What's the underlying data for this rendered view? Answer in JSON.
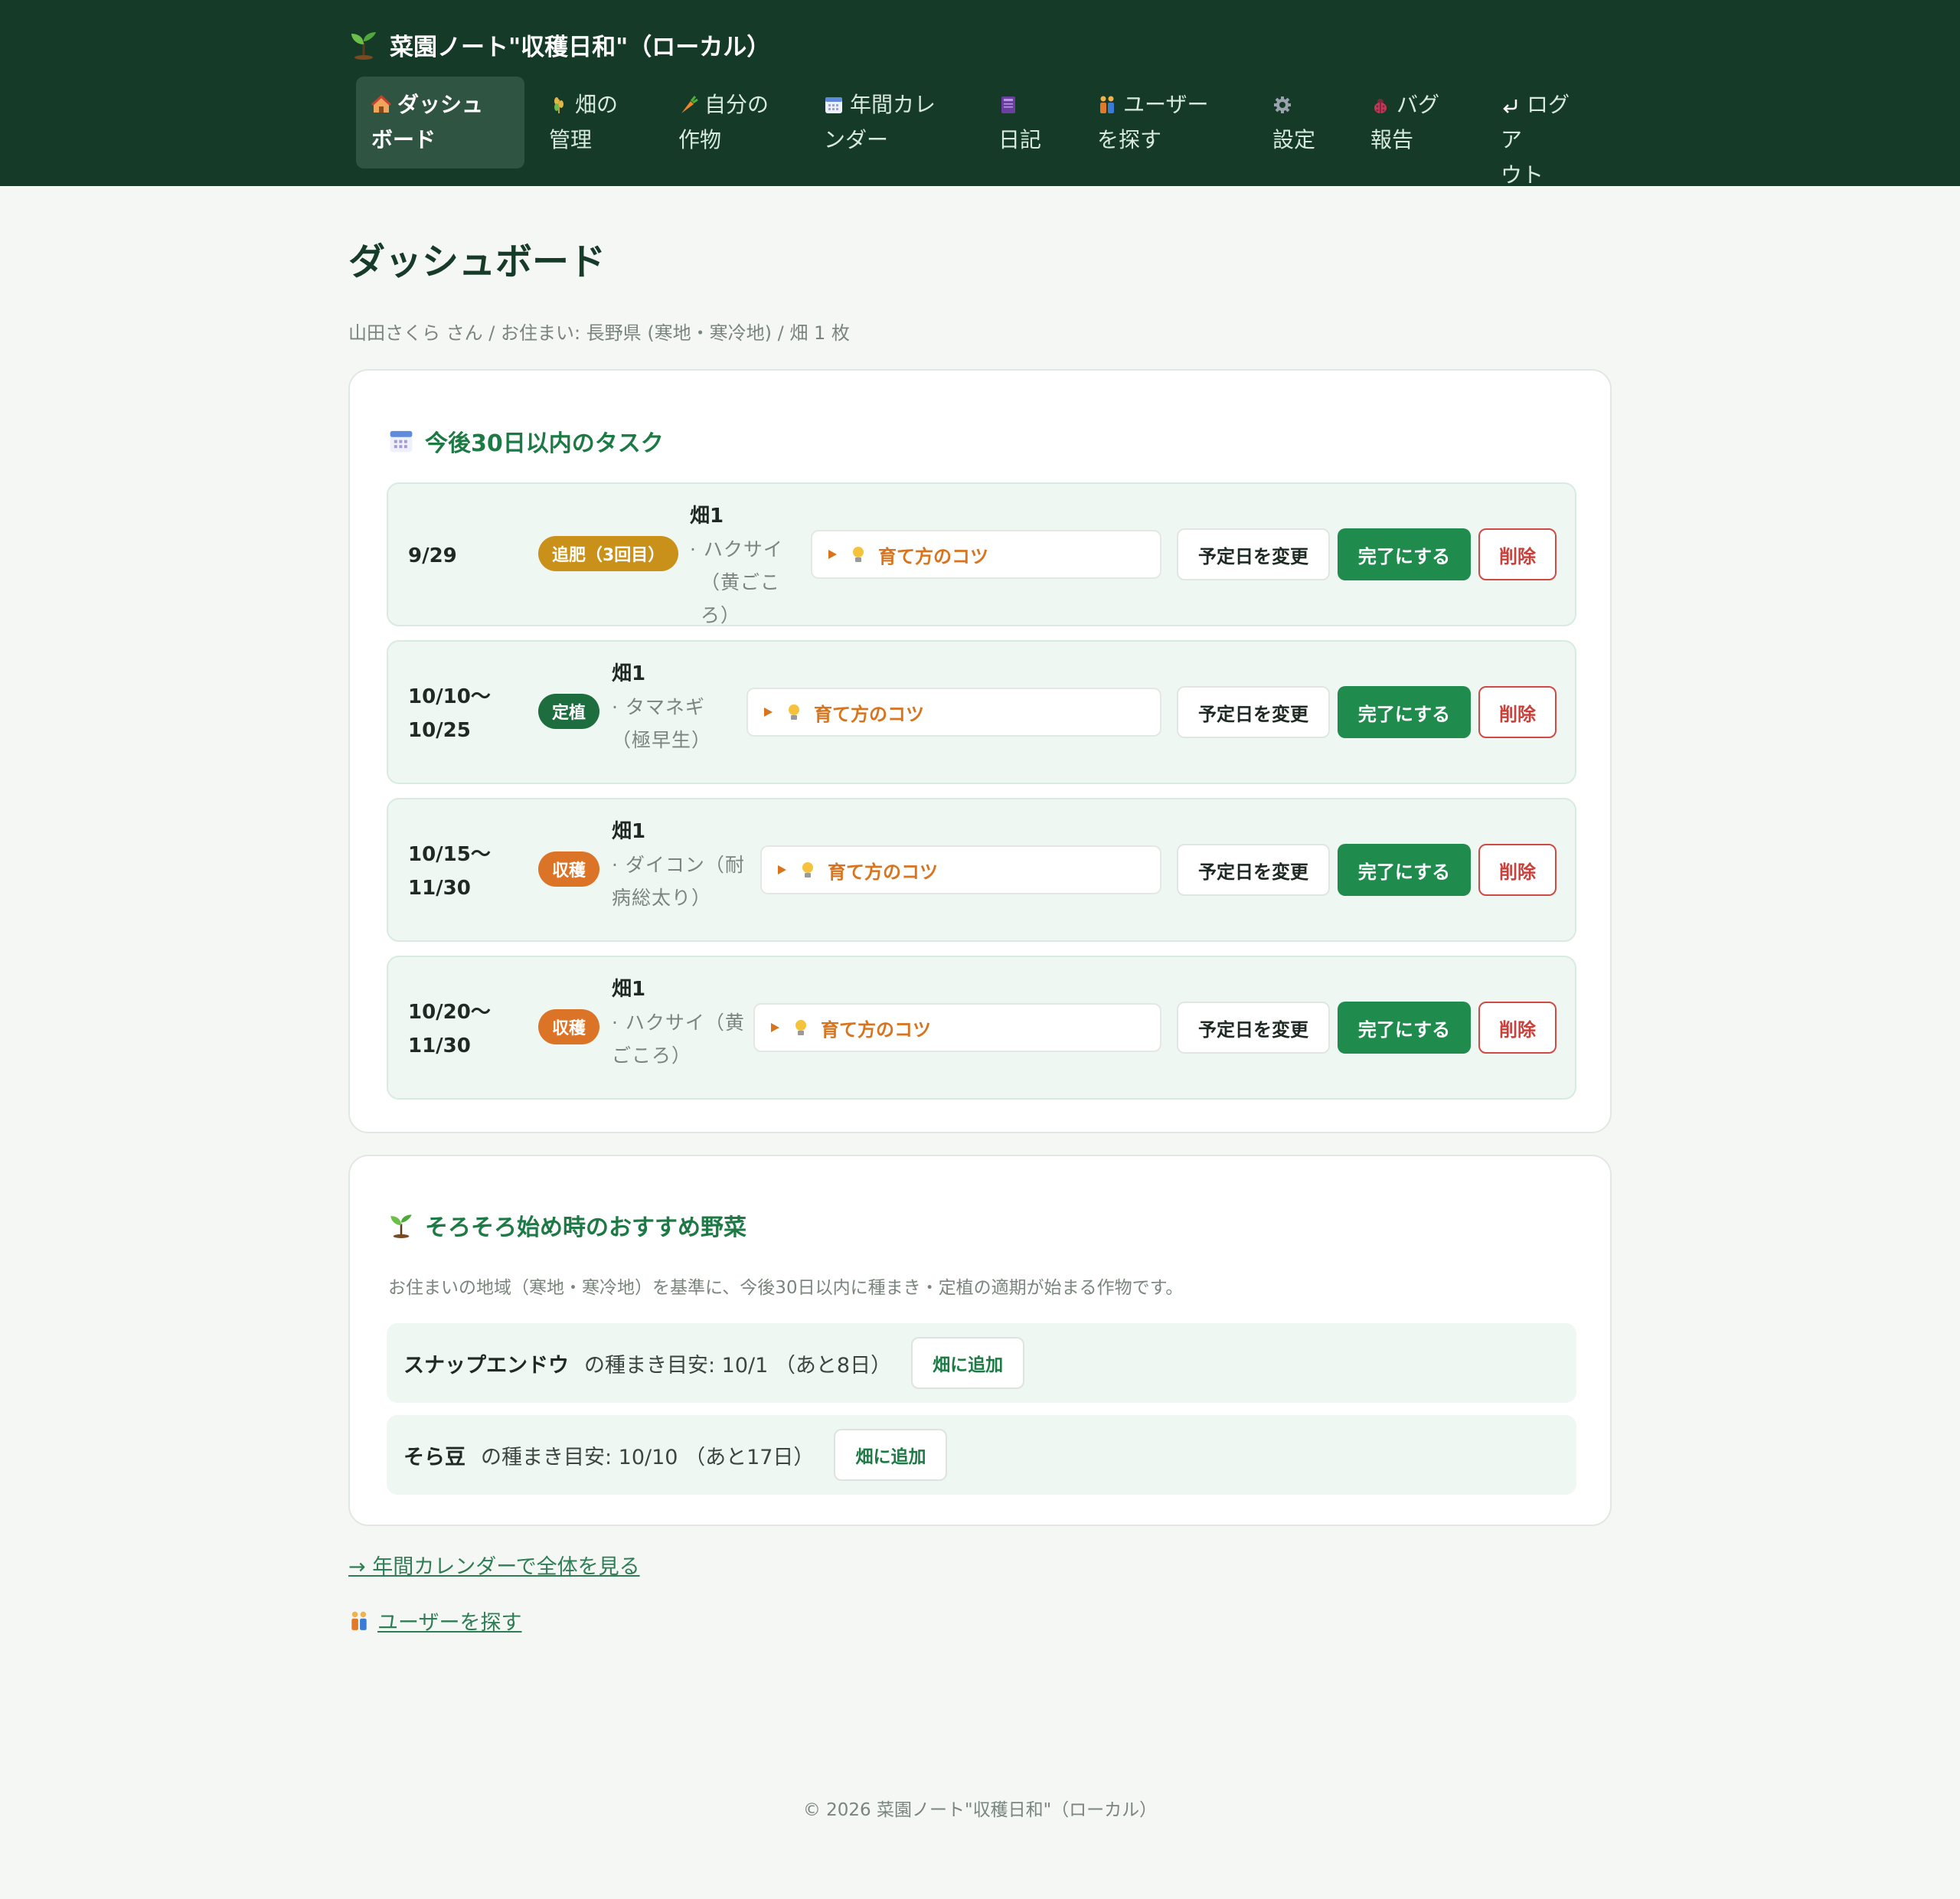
{
  "app": {
    "title": "菜園ノート\"収穫日和\"（ローカル）"
  },
  "nav": [
    {
      "label_line1": "ダッシュ",
      "label_line2": "ボード",
      "icon": "house-icon"
    },
    {
      "label_line1": "畑の",
      "label_line2": "管理",
      "icon": "wheat-icon"
    },
    {
      "label_line1": "自分の",
      "label_line2": "作物",
      "icon": "carrot-icon"
    },
    {
      "label_line1": "年間カレ",
      "label_line2": "ンダー",
      "icon": "calendar-icon"
    },
    {
      "label_line1": "",
      "label_line2": "日記",
      "icon": "notebook-icon"
    },
    {
      "label_line1": "ユーザー",
      "label_line2": "を探す",
      "icon": "people-icon"
    },
    {
      "label_line1": "",
      "label_line2": "設定",
      "icon": "gear-icon"
    },
    {
      "label_line1": "バグ",
      "label_line2": "報告",
      "icon": "bug-icon"
    },
    {
      "label_line1": "ログア",
      "label_line2": "ウト",
      "icon": "logout-arrow-icon"
    }
  ],
  "page": {
    "title": "ダッシュボード",
    "subtitle": "山田さくら さん / お住まい: 長野県 (寒地・寒冷地) / 畑 1 枚"
  },
  "tasks": {
    "heading": "今後30日以内のタスク",
    "tips_label": "育て方のコツ",
    "reschedule_label": "予定日を変更",
    "done_label": "完了にする",
    "delete_label": "削除",
    "items": [
      {
        "date_line1": "9/29",
        "date_line2": "",
        "type": "追肥（3回目）",
        "field": "畑1",
        "crop_line1": "· ハクサイ",
        "crop_line2": "（黄ごころ）"
      },
      {
        "date_line1": "10/10〜",
        "date_line2": "10/25",
        "type": "定植",
        "field": "畑1",
        "crop_line1": "· タマネギ",
        "crop_line2": "（極早生）"
      },
      {
        "date_line1": "10/15〜",
        "date_line2": "11/30",
        "type": "収穫",
        "field": "畑1",
        "crop_line1": "· ダイコン（耐",
        "crop_line2": "病総太り）"
      },
      {
        "date_line1": "10/20〜",
        "date_line2": "11/30",
        "type": "収穫",
        "field": "畑1",
        "crop_line1": "· ハクサイ（黄",
        "crop_line2": "ごころ）"
      }
    ]
  },
  "recommendations": {
    "heading": "そろそろ始め時のおすすめ野菜",
    "description": "お住まいの地域（寒地・寒冷地）を基準に、今後30日以内に種まき・定植の適期が始まる作物です。",
    "add_label": "畑に追加",
    "items": [
      {
        "crop": "スナップエンドウ",
        "text": "の種まき目安: 10/1 （あと8日）"
      },
      {
        "crop": "そら豆",
        "text": "の種まき目安: 10/10 （あと17日）"
      }
    ]
  },
  "links": {
    "calendar": "→ 年間カレンダーで全体を見る",
    "users": "ユーザーを探す"
  },
  "footer": "© 2026 菜園ノート\"収穫日和\"（ローカル）",
  "colors": {
    "header_bg": "#153a28",
    "accent_green": "#1f8c4e",
    "badge_fertilize": "#c9901a",
    "badge_plant": "#1d6d3f",
    "badge_harvest": "#dc7428",
    "delete_red": "#c9403b",
    "tips_orange": "#d9741e"
  }
}
